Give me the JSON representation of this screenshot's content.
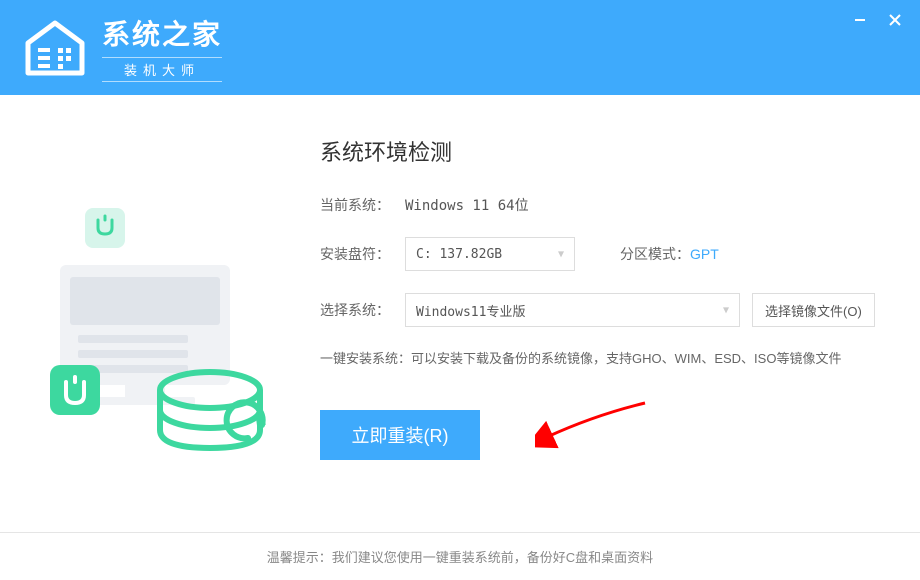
{
  "app": {
    "title": "系统之家",
    "subtitle": "装机大师"
  },
  "section_title": "系统环境检测",
  "current_system": {
    "label": "当前系统：",
    "value": "Windows 11 64位"
  },
  "install_drive": {
    "label": "安装盘符：",
    "selected": "C: 137.82GB"
  },
  "partition": {
    "label": "分区模式：",
    "value": "GPT"
  },
  "select_system": {
    "label": "选择系统：",
    "selected": "Windows11专业版"
  },
  "browse_image": "选择镜像文件(O)",
  "help_text": "一键安装系统：可以安装下载及备份的系统镜像，支持GHO、WIM、ESD、ISO等镜像文件",
  "primary_action": "立即重装(R)",
  "footer_tip": "温馨提示：我们建议您使用一键重装系统前，备份好C盘和桌面资料"
}
